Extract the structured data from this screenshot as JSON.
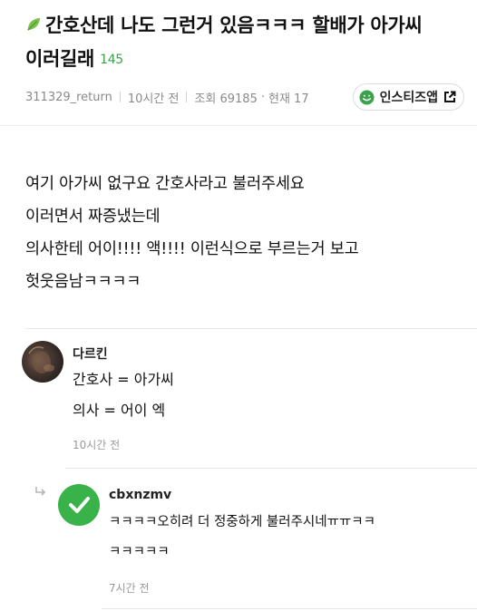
{
  "post": {
    "title_line1": "간호산데 나도 그런거 있음ㅋㅋㅋ 할배가 아가씨",
    "title_line2": "이러길래",
    "comment_count": "145",
    "author": "311329_return",
    "time": "10시간 전",
    "views": "조회 69185",
    "current": "현재 17",
    "insta_label": "인스티즈앱",
    "body_lines": [
      "여기 아가씨 없구요 간호사라고 불러주세요",
      "이러면서 짜증냈는데",
      "의사한테 어이!!!! 액!!!! 이런식으로 부르는거 보고",
      "헛웃음남ㅋㅋㅋㅋ"
    ]
  },
  "comments": [
    {
      "name": "다르킨",
      "lines": [
        "간호사 = 아가씨",
        "의사 = 어이 엑"
      ],
      "time": "10시간 전"
    },
    {
      "name": "cbxnzmv",
      "lines": [
        "ㅋㅋㅋㅋ오히려 더 정중하게 불러주시네ㅠㅠㅋㅋ",
        "ㅋㅋㅋㅋㅋ"
      ],
      "time": "7시간 전"
    }
  ],
  "icons": {
    "title": "leaf-icon",
    "insta": "smile-icon",
    "external": "external-link-icon",
    "reply": "reply-arrow-icon",
    "avatar2": "check-icon"
  },
  "colors": {
    "accent_green": "#3aa34a",
    "meta_gray": "#8a8a8a"
  }
}
